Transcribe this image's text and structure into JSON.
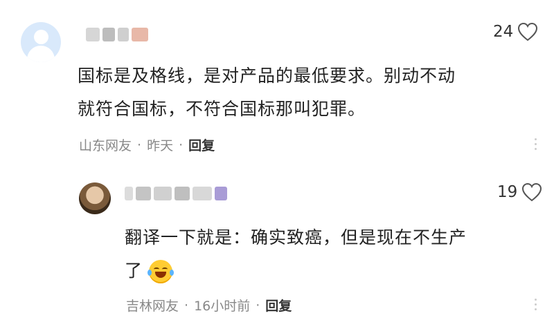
{
  "comments": [
    {
      "likes": "24",
      "text": "国标是及格线，是对产品的最低要求。别动不动就符合国标，不符合国标那叫犯罪。",
      "line1": "国标是及格线，是对产品的最低要求。别动不动",
      "line2": "就符合国标，不符合国标那叫犯罪。",
      "location": "山东网友",
      "time": "昨天",
      "reply_label": "回复",
      "sep": "·"
    },
    {
      "likes": "19",
      "line1": "翻译一下就是：确实致癌，但是现在不生产",
      "line2": "了",
      "emoji_icon": "tears-of-joy-emoji",
      "location": "吉林网友",
      "time": "16小时前",
      "reply_label": "回复",
      "sep": "·"
    }
  ],
  "colors": {
    "meta": "#888888",
    "avatar_bg": "#d9e9fb",
    "heart_stroke": "#555555"
  }
}
